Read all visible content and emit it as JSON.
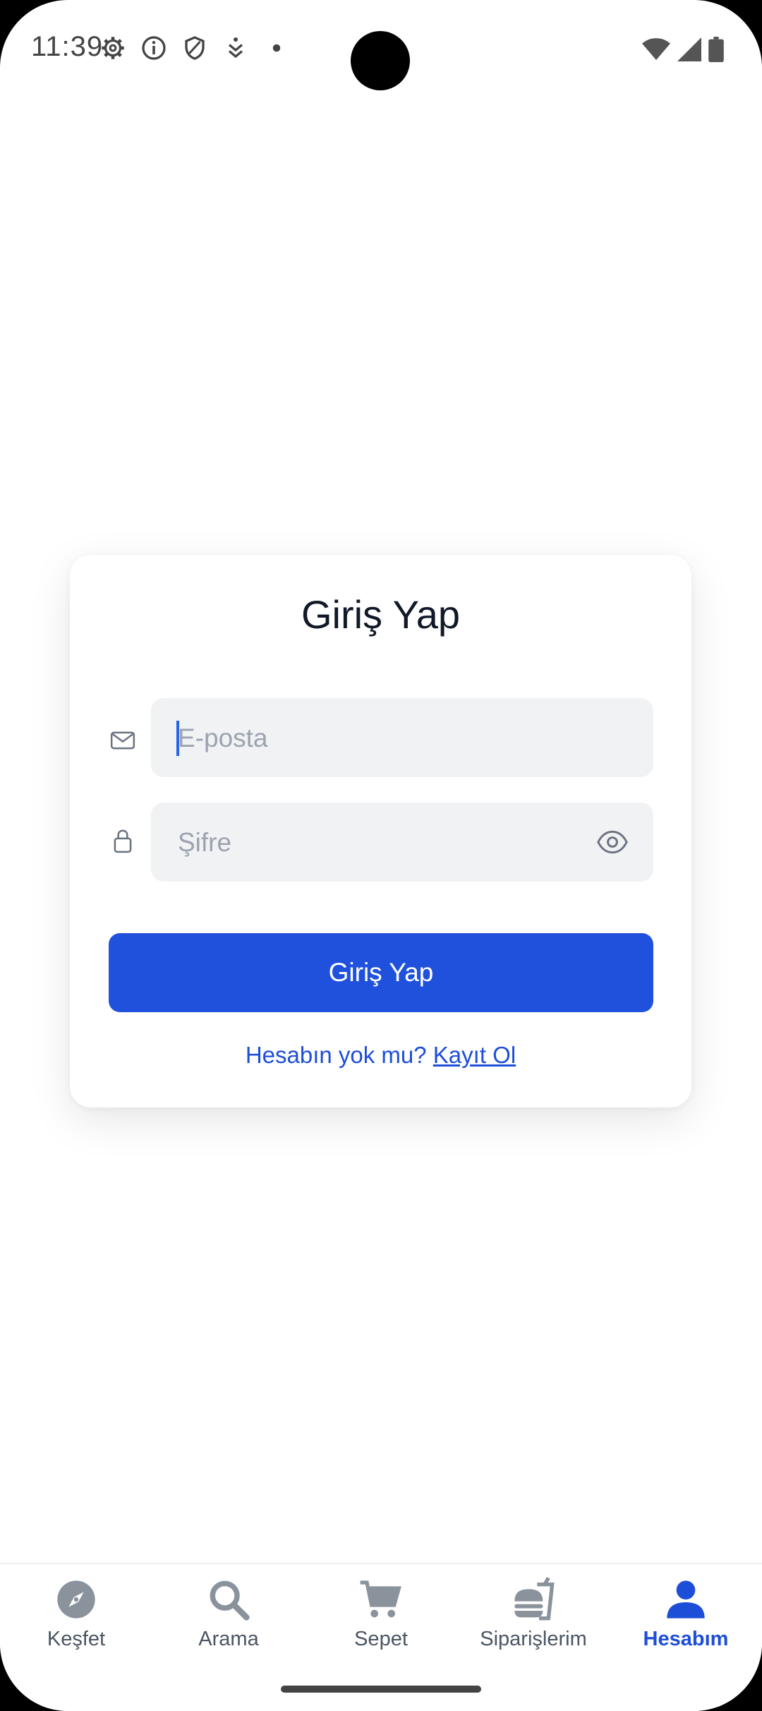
{
  "status_bar": {
    "time": "11:39"
  },
  "login": {
    "title": "Giriş Yap",
    "email_placeholder": "E-posta",
    "password_placeholder": "Şifre",
    "submit_label": "Giriş Yap",
    "signup_prompt": "Hesabın yok mu?",
    "signup_link": "Kayıt Ol"
  },
  "bottom_nav": {
    "items": [
      {
        "label": "Keşfet",
        "icon": "compass-icon"
      },
      {
        "label": "Arama",
        "icon": "search-icon"
      },
      {
        "label": "Sepet",
        "icon": "cart-icon"
      },
      {
        "label": "Siparişlerim",
        "icon": "food-delivery-icon"
      },
      {
        "label": "Hesabım",
        "icon": "user-icon"
      }
    ],
    "active_index": 4
  },
  "colors": {
    "primary": "#1f51dc",
    "link": "#1d4ed8",
    "inactive_icon": "#8a929c",
    "field_bg": "#f1f2f4"
  }
}
